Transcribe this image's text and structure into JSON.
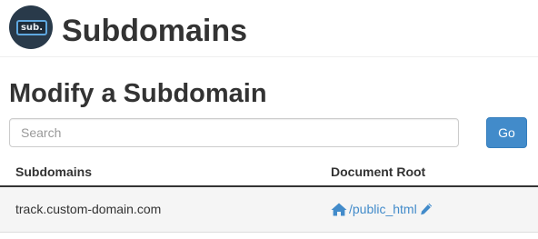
{
  "header": {
    "icon_text": "sub.",
    "icon_name": "subdomains-app-icon",
    "title": "Subdomains"
  },
  "section": {
    "title": "Modify a Subdomain"
  },
  "search": {
    "placeholder": "Search",
    "value": "",
    "go_label": "Go"
  },
  "table": {
    "columns": [
      "Subdomains",
      "Document Root"
    ],
    "rows": [
      {
        "subdomain": "track.custom-domain.com",
        "document_root": "/public_html",
        "root_icon": "home-icon",
        "edit_icon": "pencil-icon"
      }
    ]
  },
  "colors": {
    "primary": "#428bca",
    "text": "#333333",
    "row_background": "#f5f5f5",
    "icon_background": "#293a4a"
  }
}
